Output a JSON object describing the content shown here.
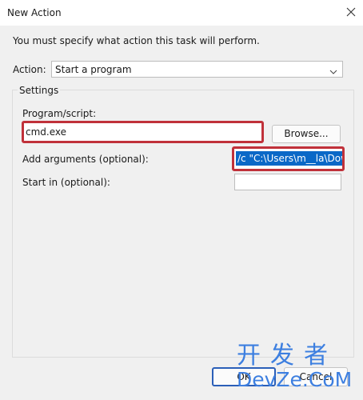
{
  "window": {
    "title": "New Action"
  },
  "description": "You must specify what action this task will perform.",
  "action": {
    "label": "Action:",
    "value": "Start a program"
  },
  "settings": {
    "group_label": "Settings",
    "program_label": "Program/script:",
    "program_value": "cmd.exe",
    "browse_label": "Browse...",
    "arguments_label": "Add arguments (optional):",
    "arguments_value": "/c \"C:\\Users\\m__la\\Dow",
    "start_in_label": "Start in (optional):",
    "start_in_value": ""
  },
  "buttons": {
    "ok_label": "OK",
    "cancel_label": "Cancel"
  },
  "watermark": {
    "line1": "开发者",
    "line2": "DevZe.CoM"
  },
  "colors": {
    "highlight_border": "#c0313a",
    "selection": "#0a68c7",
    "watermark": "#3d7fe0"
  },
  "icons": {
    "close": "close-icon",
    "dropdown": "chevron-down-icon"
  }
}
